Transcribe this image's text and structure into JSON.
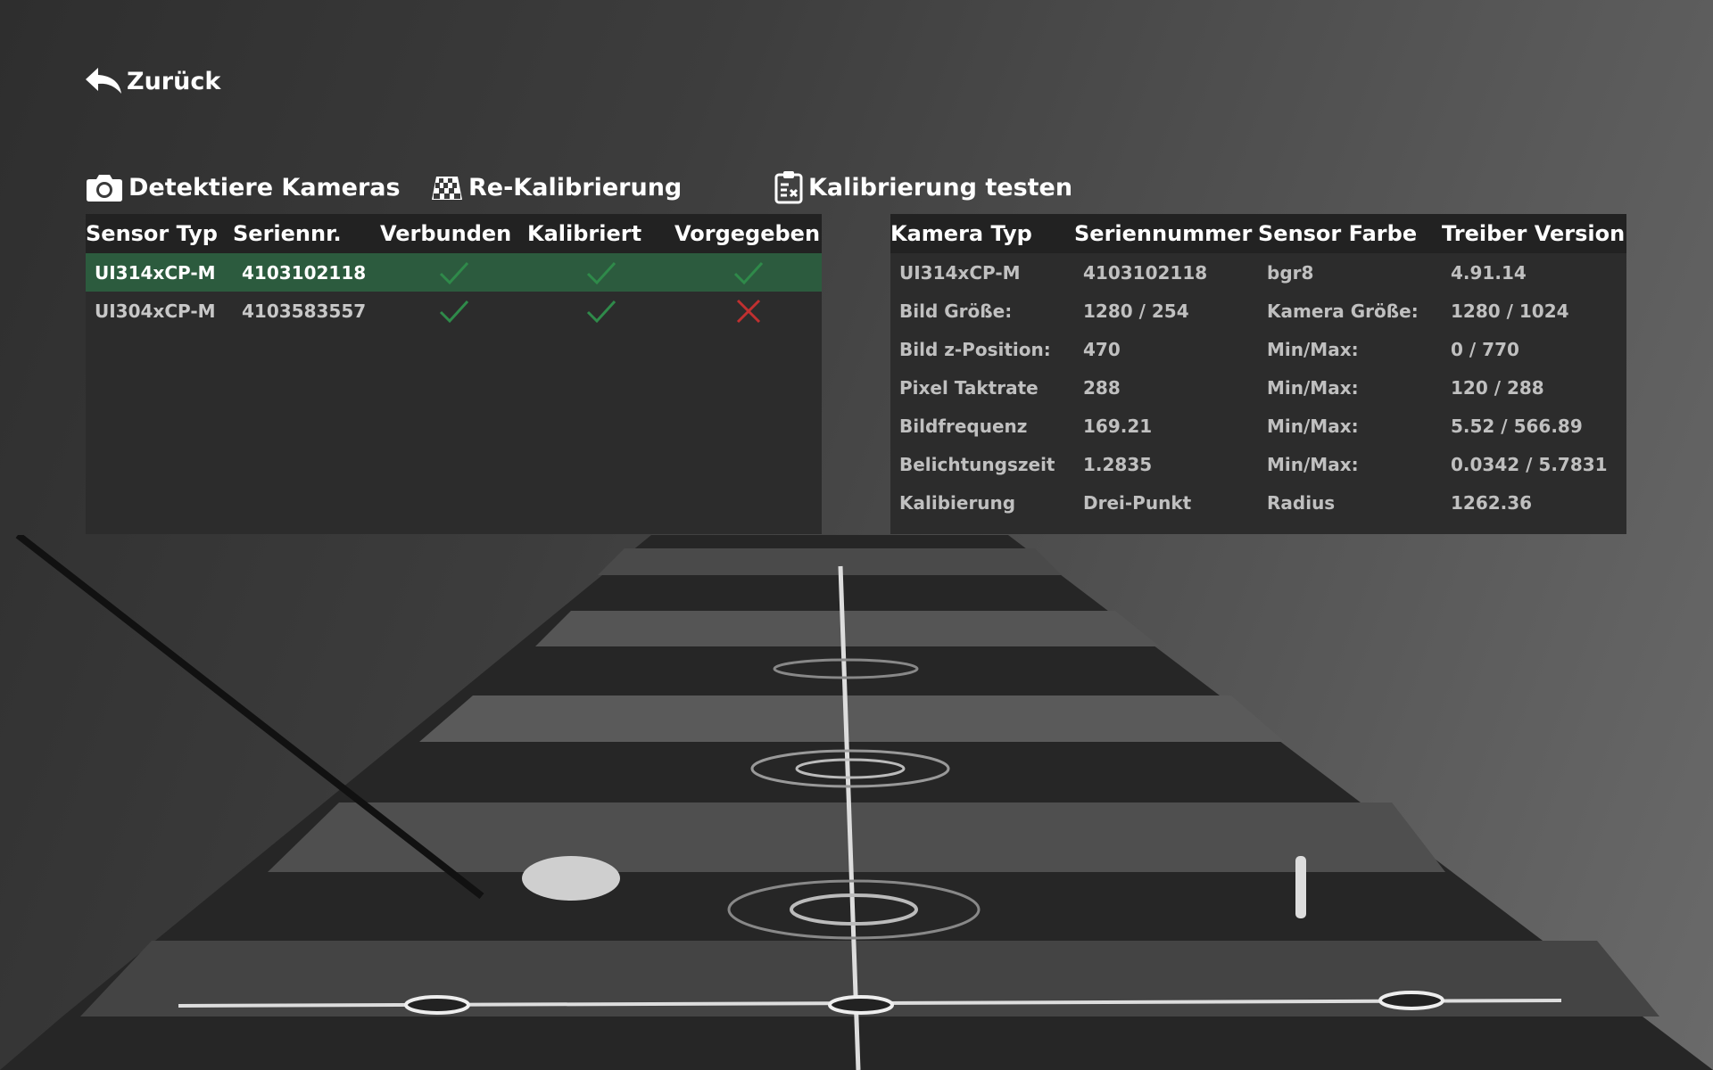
{
  "nav": {
    "back_label": "Zurück"
  },
  "toolbar": {
    "detect_label": "Detektiere Kameras",
    "recal_label": "Re-Kalibrierung",
    "test_label": "Kalibrierung testen"
  },
  "sensor_table": {
    "headers": [
      "Sensor Typ",
      "Seriennr.",
      "Verbunden",
      "Kalibriert",
      "Vorgegeben"
    ],
    "rows": [
      {
        "type": "UI314xCP-M",
        "serial": "4103102118",
        "connected": "check",
        "calibrated": "check",
        "default": "check",
        "selected": true
      },
      {
        "type": "UI304xCP-M",
        "serial": "4103583557",
        "connected": "check",
        "calibrated": "check",
        "default": "cross",
        "selected": false
      }
    ]
  },
  "camera_info": {
    "headers": [
      "Kamera Typ",
      "Seriennummer",
      "Sensor Farbe",
      "Treiber Version"
    ],
    "rows": [
      [
        "UI314xCP-M",
        "4103102118",
        "bgr8",
        "4.91.14"
      ],
      [
        "Bild Größe:",
        "1280 / 254",
        "Kamera Größe:",
        "1280 / 1024"
      ],
      [
        "Bild z-Position:",
        "470",
        "Min/Max:",
        "0 / 770"
      ],
      [
        "Pixel Taktrate",
        "288",
        "Min/Max:",
        "120 / 288"
      ],
      [
        "Bildfrequenz",
        "169.21",
        "Min/Max:",
        "5.52 / 566.89"
      ],
      [
        "Belichtungszeit",
        "1.2835",
        "Min/Max:",
        "0.0342 / 5.7831"
      ],
      [
        "Kalibierung",
        "Drei-Punkt",
        "Radius",
        "1262.36"
      ]
    ]
  },
  "colors": {
    "selected_row": "#2c5b3e",
    "check": "#2f8a4a",
    "cross": "#c03030",
    "panel_bg": "#2c2c2c",
    "header_bg": "#222222"
  }
}
